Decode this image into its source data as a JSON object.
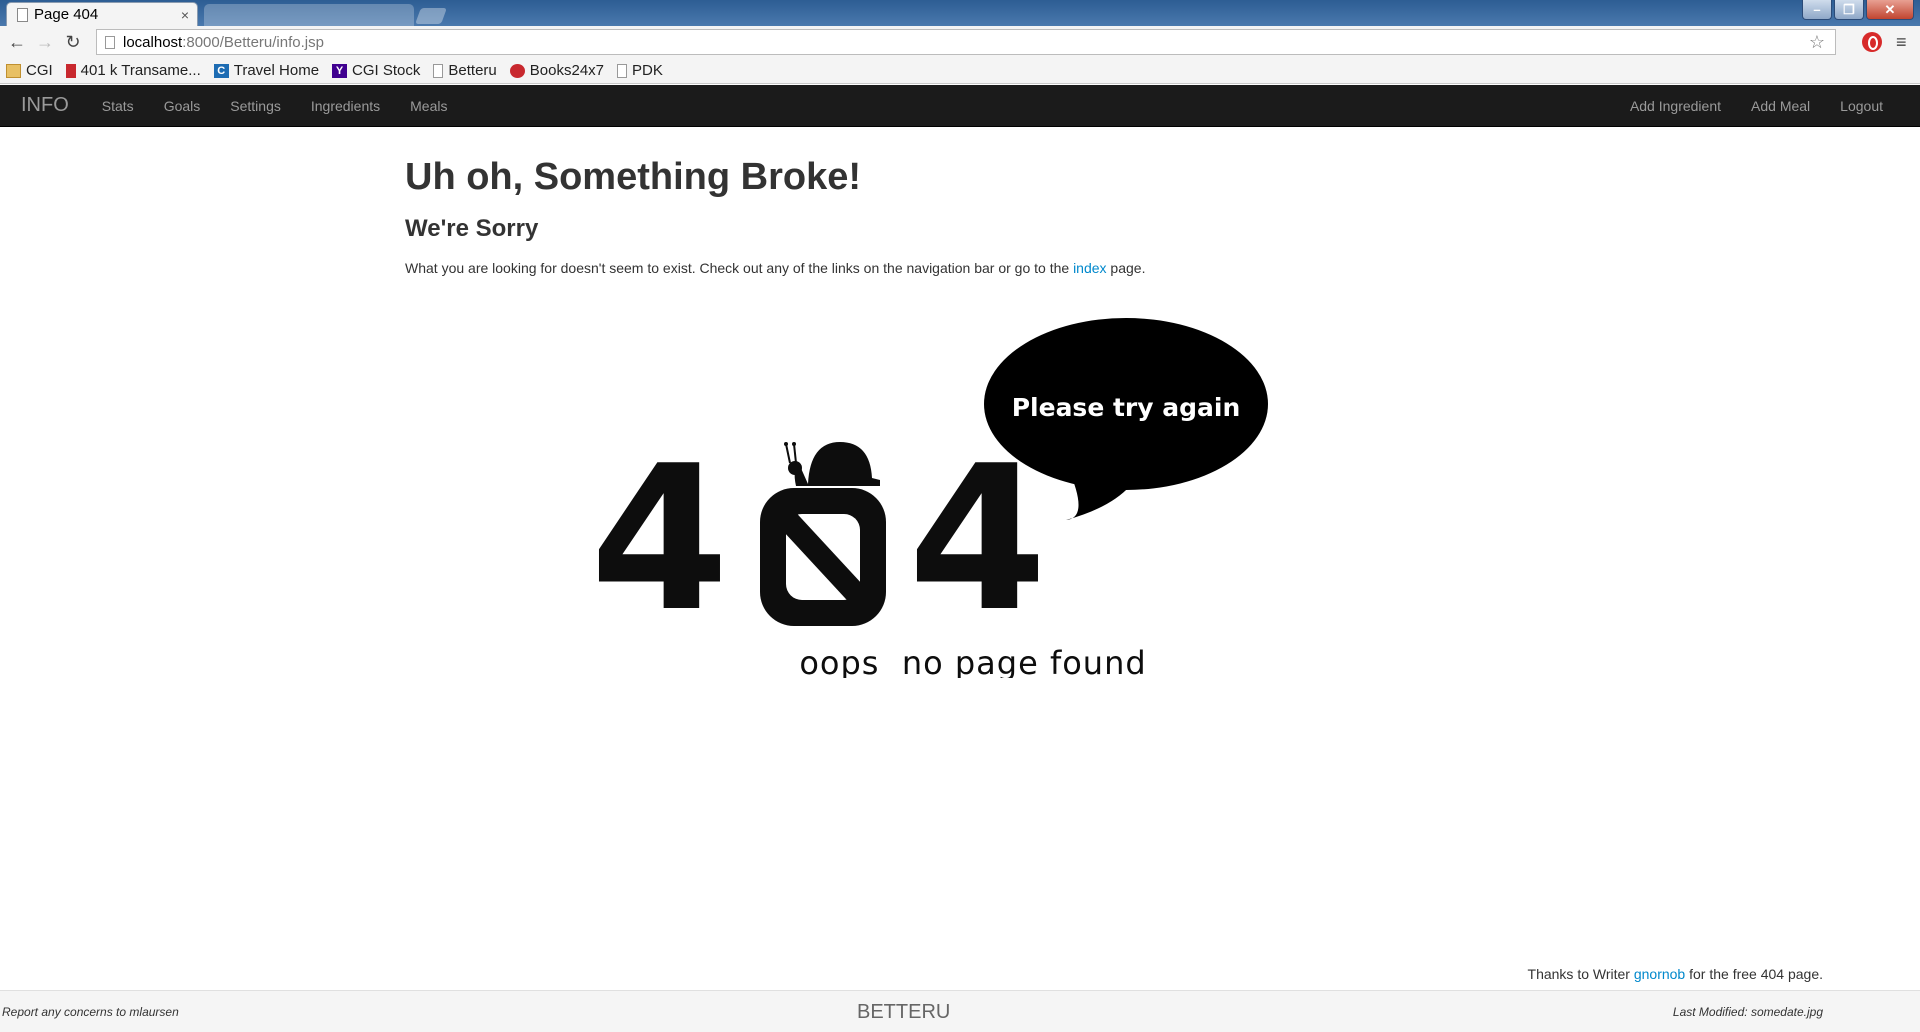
{
  "browser": {
    "active_tab_title": "Page 404",
    "url_host": "localhost",
    "url_rest": ":8000/Betteru/info.jsp",
    "bookmarks": [
      {
        "label": "CGI",
        "icon": "folder-icon"
      },
      {
        "label": "401 k Transame...",
        "icon": "transamerica-icon"
      },
      {
        "label": "Travel Home",
        "icon": "travel-icon"
      },
      {
        "label": "CGI Stock",
        "icon": "yahoo-icon"
      },
      {
        "label": "Betteru",
        "icon": "page-icon"
      },
      {
        "label": "Books24x7",
        "icon": "books24x7-icon"
      },
      {
        "label": "PDK",
        "icon": "page-icon"
      }
    ]
  },
  "navbar": {
    "brand": "INFO",
    "left_links": [
      "Stats",
      "Goals",
      "Settings",
      "Ingredients",
      "Meals"
    ],
    "right_links": [
      "Add Ingredient",
      "Add Meal",
      "Logout"
    ]
  },
  "content": {
    "heading": "Uh oh, Something Broke!",
    "subheading": "We're Sorry",
    "text_before": "What you are looking for doesn't seem to exist. Check out any of the links on the navigation bar or go to the ",
    "index_link": "index",
    "text_after": " page."
  },
  "illustration": {
    "bubble_text": "Please try again",
    "caption": "oops  no page found",
    "digit_left": "4",
    "digit_right": "4"
  },
  "credit": {
    "prefix": "Thanks to Writer ",
    "author_link": "gnornob",
    "suffix": " for the free 404 page."
  },
  "footer": {
    "left": "Report any concerns to mlaursen",
    "center": "BETTERU",
    "right": "Last Modified: somedate.jpg"
  },
  "colors": {
    "navbar_bg": "#1b1b1b",
    "link": "#0088cc",
    "text": "#333333"
  }
}
